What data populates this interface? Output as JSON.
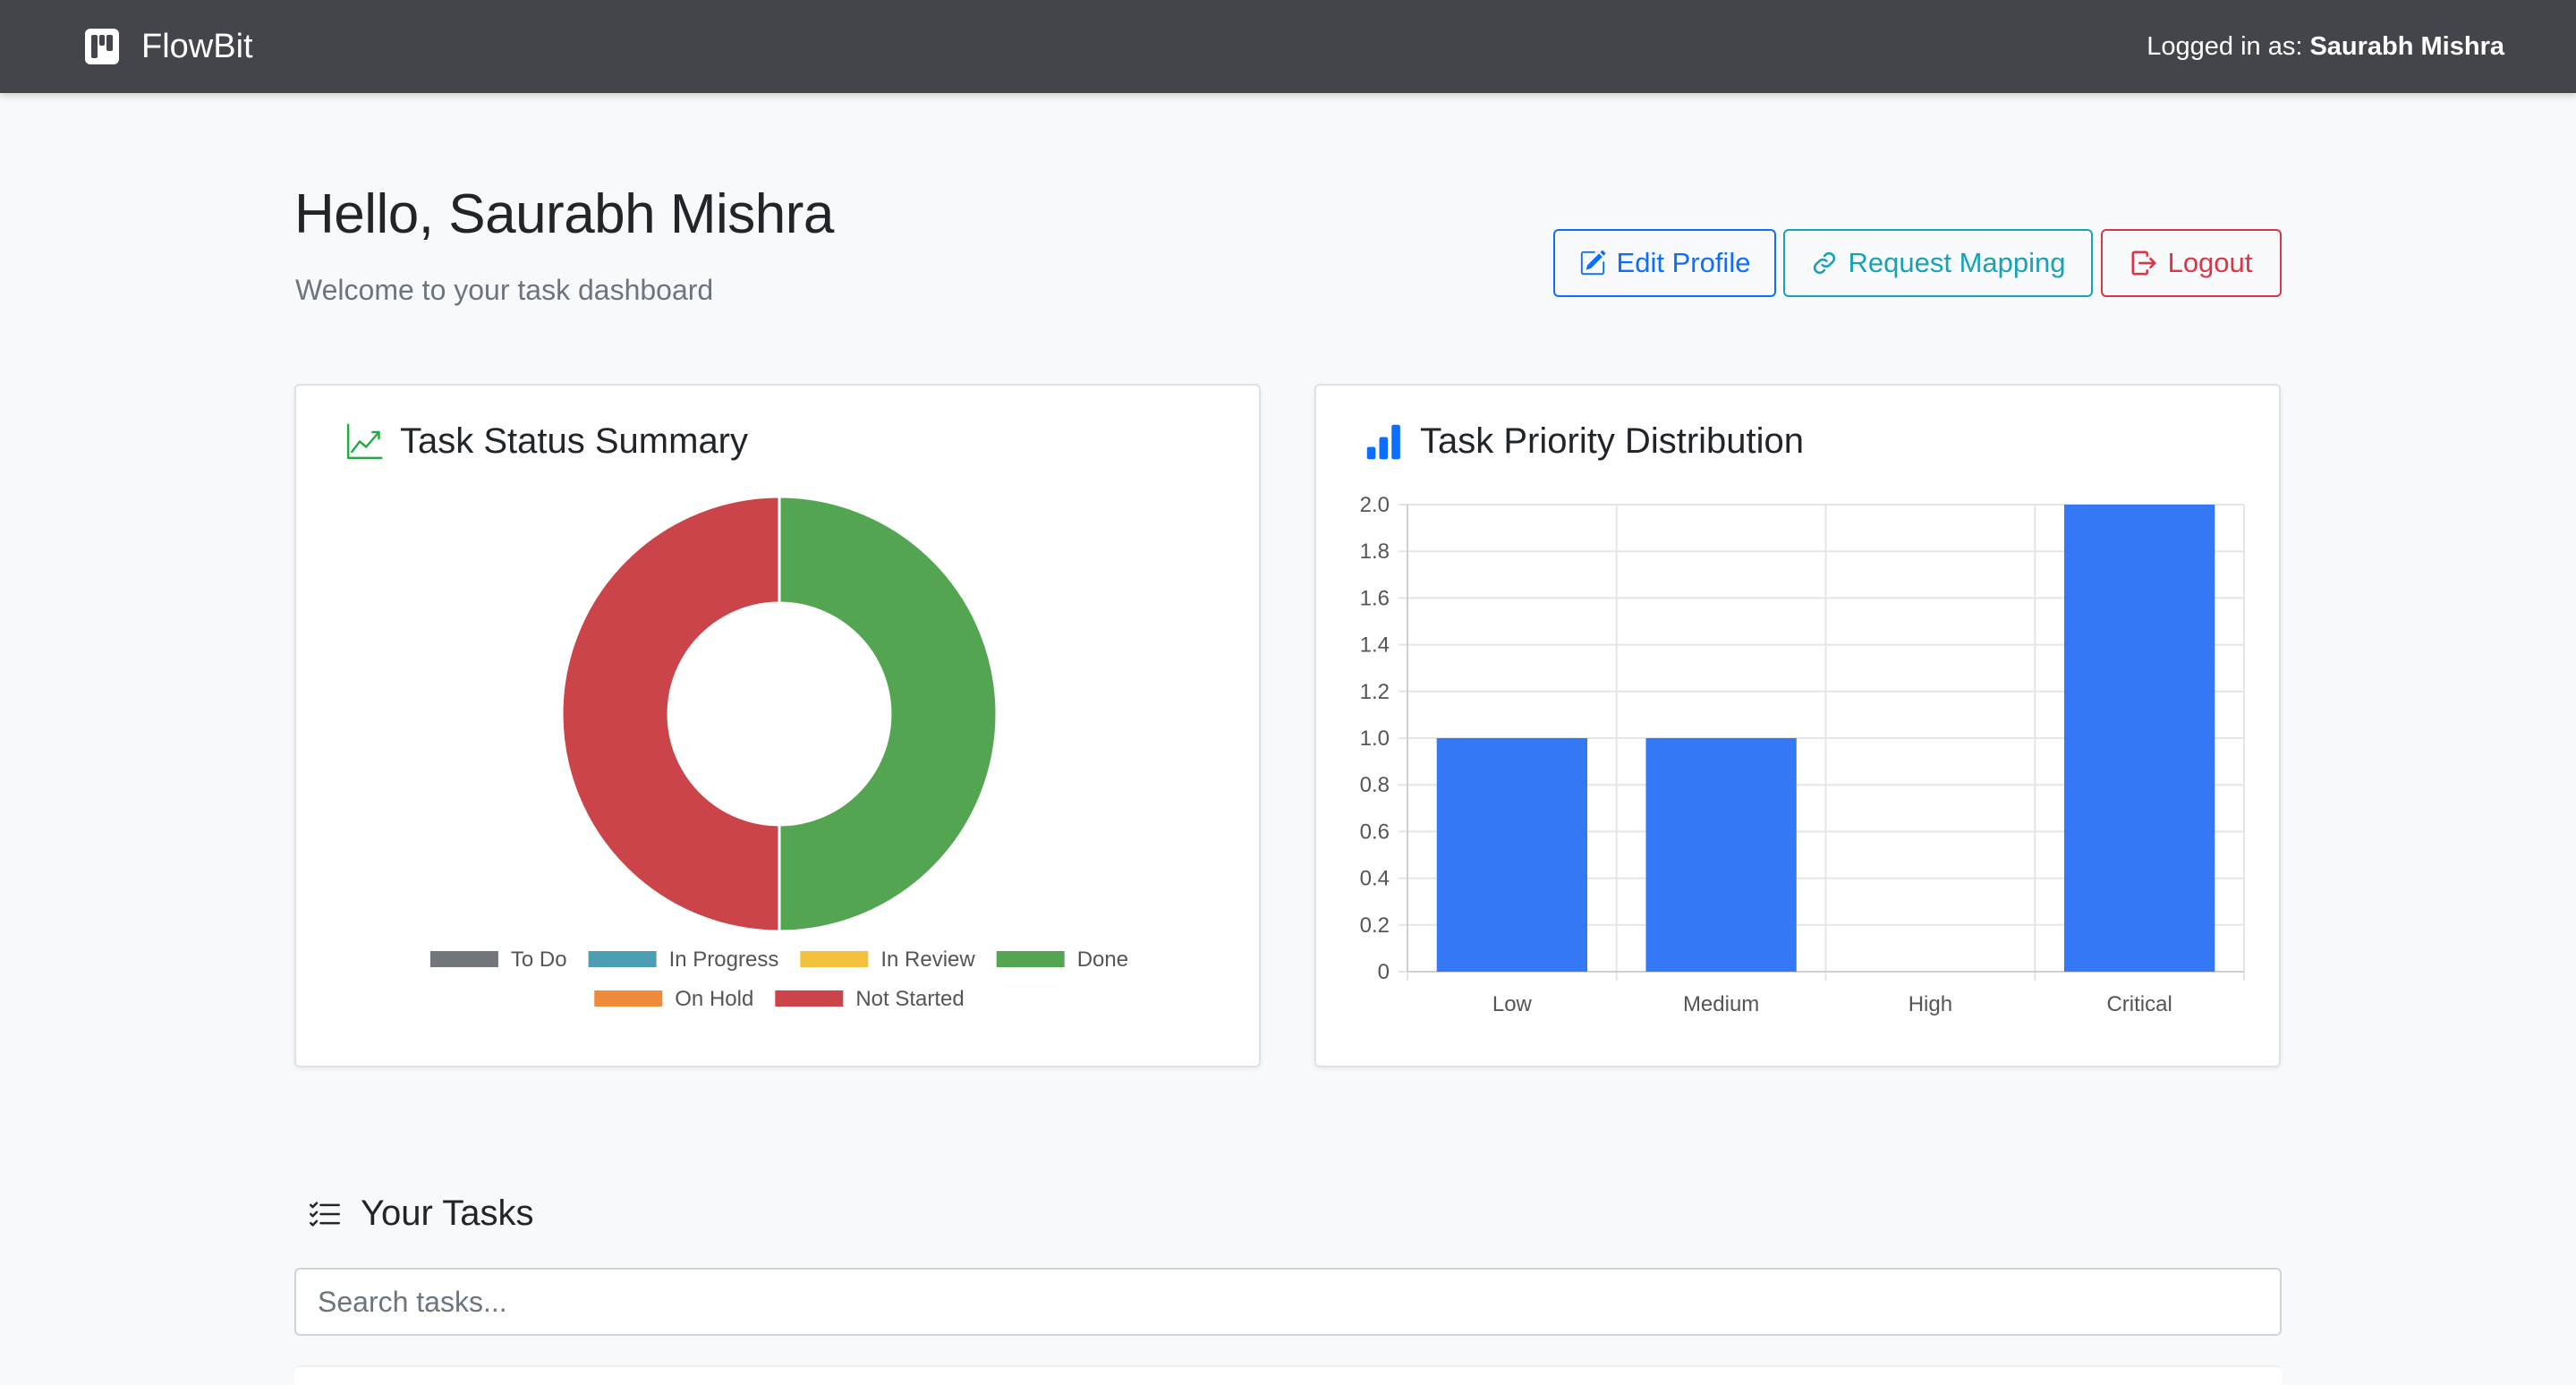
{
  "navbar": {
    "brand": "FlowBit",
    "brand_icon": "kanban-icon",
    "login_label": "Logged in as:",
    "user_name": "Saurabh Mishra"
  },
  "header": {
    "greeting": "Hello, Saurabh Mishra",
    "subtitle": "Welcome to your task dashboard"
  },
  "actions": {
    "edit_profile": "Edit Profile",
    "request_mapping": "Request Mapping",
    "logout": "Logout"
  },
  "colors": {
    "primary": "#0d6efd",
    "info": "#17a2b8",
    "danger": "#dc3545",
    "navbar": "#43454a",
    "done": "#53a551",
    "not_started": "#cb4449",
    "bar": "#3478f6"
  },
  "status_card": {
    "title": "Task Status Summary",
    "icon": "graph-up-icon"
  },
  "priority_card": {
    "title": "Task Priority Distribution",
    "icon": "bar-chart-icon"
  },
  "tasks": {
    "title": "Your Tasks",
    "icon": "list-check-icon",
    "search_placeholder": "Search tasks..."
  },
  "chart_data": [
    {
      "type": "pie",
      "title": "Task Status Summary",
      "categories": [
        "To Do",
        "In Progress",
        "In Review",
        "Done",
        "On Hold",
        "Not Started"
      ],
      "values": [
        0,
        0,
        0,
        1,
        0,
        1
      ],
      "colors": [
        "#6c757d",
        "#17a2b8",
        "#ffc107",
        "#28a745",
        "#fd7e14",
        "#dc3545"
      ],
      "display_colors": [
        "#72757a",
        "#4c9fb2",
        "#f4c13f",
        "#53a551",
        "#ee8a3a",
        "#cb4449"
      ],
      "legend": "bottom"
    },
    {
      "type": "bar",
      "title": "Task Priority Distribution",
      "categories": [
        "Low",
        "Medium",
        "High",
        "Critical"
      ],
      "values": [
        1,
        1,
        0,
        2
      ],
      "yticks": [
        "0",
        "0.2",
        "0.4",
        "0.6",
        "0.8",
        "1.0",
        "1.2",
        "1.4",
        "1.6",
        "1.8",
        "2.0"
      ],
      "ylim": [
        0,
        2
      ],
      "grid": true,
      "xlabel": "",
      "ylabel": ""
    }
  ]
}
